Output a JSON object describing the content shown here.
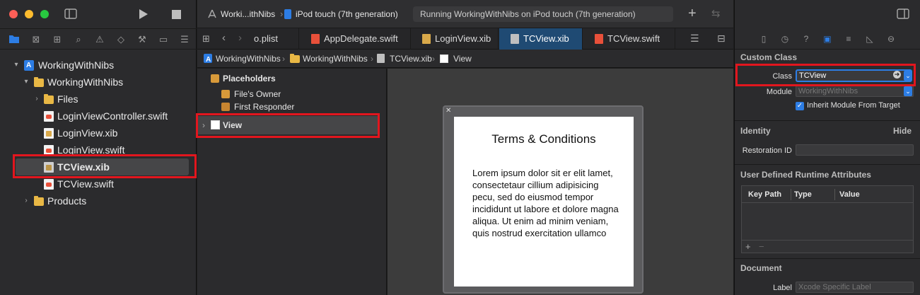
{
  "toolbar": {
    "scheme": "Worki...ithNibs",
    "destination": "iPod touch (7th generation)",
    "status": "Running WorkingWithNibs on iPod touch (7th generation)",
    "add_label": "+"
  },
  "tabs": [
    {
      "label": "o.plist"
    },
    {
      "label": "AppDelegate.swift"
    },
    {
      "label": "LoginView.xib"
    },
    {
      "label": "TCView.xib",
      "active": true
    },
    {
      "label": "TCView.swift"
    }
  ],
  "jumpbar": {
    "items": [
      "WorkingWithNibs",
      "WorkingWithNibs",
      "TCView.xib",
      "View"
    ]
  },
  "navigator": {
    "items": [
      {
        "label": "WorkingWithNibs"
      },
      {
        "label": "WorkingWithNibs"
      },
      {
        "label": "Files"
      },
      {
        "label": "LoginViewController.swift"
      },
      {
        "label": "LoginView.xib"
      },
      {
        "label": "LoginView.swift"
      },
      {
        "label": "TCView.xib"
      },
      {
        "label": "TCView.swift"
      },
      {
        "label": "Products"
      }
    ]
  },
  "outline": {
    "placeholders": "Placeholders",
    "files_owner": "File's Owner",
    "first_responder": "First Responder",
    "view": "View"
  },
  "canvas": {
    "title": "Terms & Conditions",
    "body": "Lorem ipsum dolor sit er elit lamet, consectetaur cillium adipisicing pecu, sed do eiusmod tempor incididunt ut labore et dolore magna aliqua. Ut enim ad minim veniam, quis nostrud exercitation ullamco"
  },
  "inspector": {
    "custom_class": {
      "header": "Custom Class",
      "class_label": "Class",
      "class_value": "TCView",
      "module_label": "Module",
      "module_placeholder": "WorkingWithNibs",
      "inherit_label": "Inherit Module From Target"
    },
    "identity": {
      "header": "Identity",
      "hide": "Hide",
      "restoration_label": "Restoration ID"
    },
    "runtime": {
      "header": "User Defined Runtime Attributes",
      "col_keypath": "Key Path",
      "col_type": "Type",
      "col_value": "Value",
      "add": "+",
      "remove": "−"
    },
    "document": {
      "header": "Document",
      "label_label": "Label",
      "label_placeholder": "Xcode Specific Label"
    }
  },
  "colors": {
    "accent": "#2d7de4",
    "highlight": "#e2161e",
    "active_tab": "#1f4a73"
  }
}
